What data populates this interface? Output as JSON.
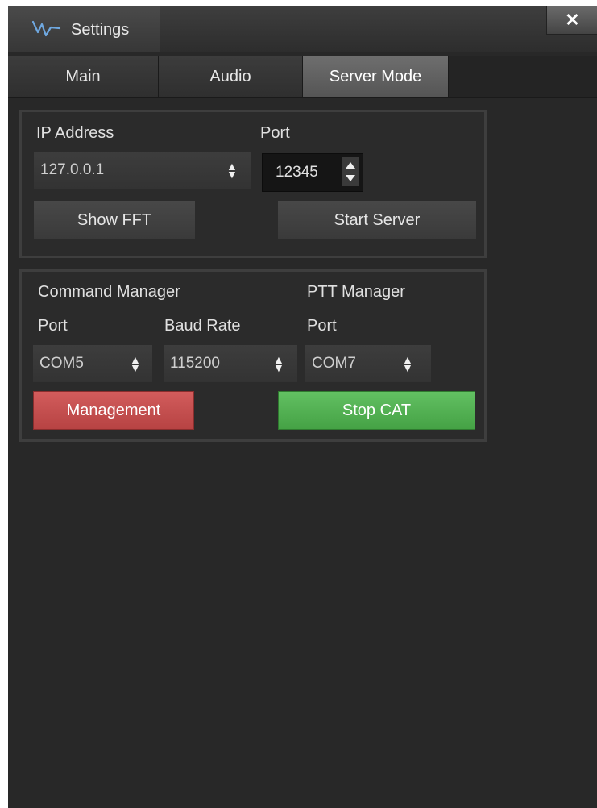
{
  "window": {
    "title": "Settings",
    "close_label": "✕"
  },
  "tabs": [
    {
      "label": "Main",
      "active": false
    },
    {
      "label": "Audio",
      "active": false
    },
    {
      "label": "Server Mode",
      "active": true
    }
  ],
  "server_panel": {
    "ip_label": "IP Address",
    "ip_value": "127.0.0.1",
    "port_label": "Port",
    "port_value": "12345",
    "show_fft_label": "Show FFT",
    "start_server_label": "Start Server"
  },
  "cat_panel": {
    "command_manager_label": "Command Manager",
    "ptt_manager_label": "PTT Manager",
    "command_port_label": "Port",
    "baud_rate_label": "Baud Rate",
    "ptt_port_label": "Port",
    "command_port_value": "COM5",
    "baud_rate_value": "115200",
    "ptt_port_value": "COM7",
    "management_label": "Management",
    "stop_cat_label": "Stop CAT"
  },
  "colors": {
    "background": "#282828",
    "management_red": "#c24d4d",
    "stop_cat_green": "#52b052"
  },
  "icons": {
    "app": "waveform-icon",
    "close": "close-icon",
    "spinner": "spinner-arrows-icon",
    "combo": "up-down-arrows-icon"
  }
}
